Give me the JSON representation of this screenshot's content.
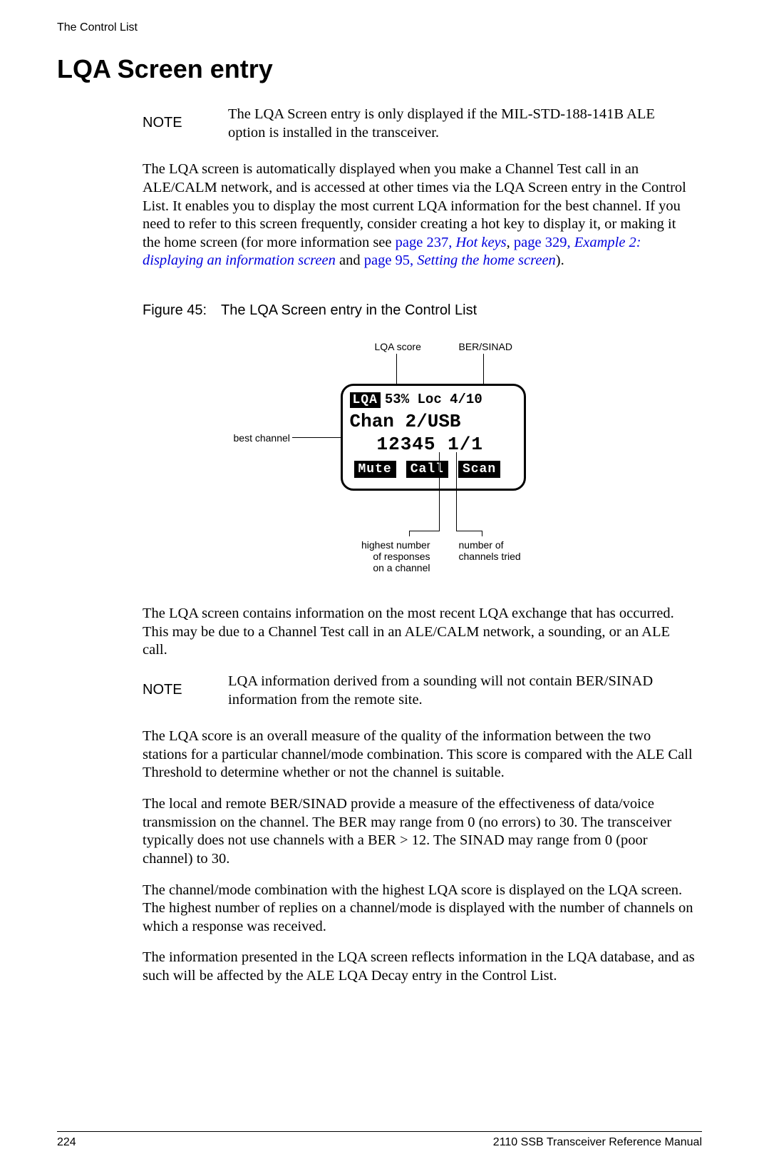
{
  "header": {
    "running_head": "The Control List"
  },
  "title": "LQA Screen entry",
  "note1": {
    "label": "NOTE",
    "text": "The LQA Screen entry is only displayed if the MIL-STD-188-141B ALE option is installed in the transceiver."
  },
  "para1_pre": "The LQA screen is automatically displayed when you make a Channel Test call in an ALE/CALM network, and is accessed at other times via the LQA Screen entry in the Control List. It enables you to display the most current LQA information for the best channel. If you need to refer to this screen frequently, consider creating a hot key to display it, or making it the home screen (for more information see ",
  "link1a": "page 237, ",
  "link1a_ital": "Hot keys",
  "para1_mid1": ", ",
  "link1b": "page 329, ",
  "link1b_ital": "Example 2: displaying an information screen",
  "para1_mid2": " and ",
  "link1c": "page 95, ",
  "link1c_ital": "Setting the home screen",
  "para1_post": ").",
  "figure": {
    "caption": "Figure 45: The LQA Screen entry in the Control List",
    "callouts": {
      "lqa_score": "LQA score",
      "ber_sinad": "BER/SINAD",
      "best_channel": "best channel",
      "highest": "highest number\nof responses\non a channel",
      "num_tried": "number of\nchannels tried"
    },
    "lcd": {
      "badge": "LQA",
      "line1_rest": "53% Loc 4/10",
      "line2": "Chan 2/USB",
      "line3": "12345 1/1",
      "btn_mute": "Mute",
      "btn_call": "Call",
      "btn_scan": "Scan"
    }
  },
  "para2": "The LQA screen contains information on the most recent LQA exchange that has occurred. This may be due to a Channel Test call in an ALE/CALM network, a sounding, or an ALE call.",
  "note2": {
    "label": "NOTE",
    "text": "LQA information derived from a sounding will not contain BER/SINAD information from the remote site."
  },
  "para3": "The LQA score is an overall measure of the quality of the information between the two stations for a particular channel/mode combination. This score is compared with the ALE Call Threshold to determine whether or not the channel is suitable.",
  "para4": "The local and remote BER/SINAD provide a measure of the effectiveness of data/voice transmission on the channel. The BER may range from 0 (no errors) to 30. The transceiver typically does not use channels with a BER > 12. The SINAD may range from 0 (poor channel) to 30.",
  "para5": "The channel/mode combination with the highest LQA score is displayed on the LQA screen. The highest number of replies on a channel/mode is displayed with the number of channels on which a response was received.",
  "para6": "The information presented in the LQA screen reflects information in the LQA database, and as such will be affected by the ALE LQA Decay entry in the Control List.",
  "footer": {
    "page": "224",
    "doc": "2110 SSB Transceiver Reference Manual"
  }
}
